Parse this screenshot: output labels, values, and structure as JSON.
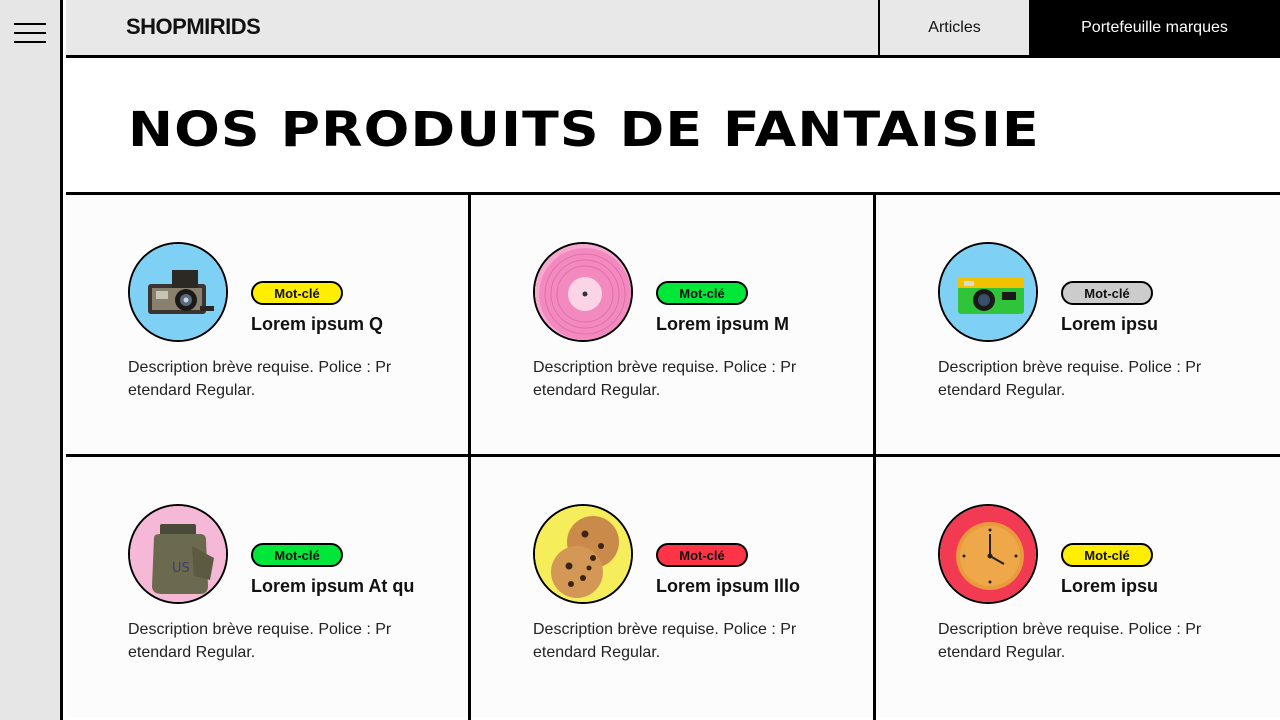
{
  "brand": "SHOPMIRIDS",
  "nav": {
    "articles": "Articles",
    "brands": "Portefeuille marques"
  },
  "hero": {
    "title": "NOS PRODUITS DE FANTAISIE"
  },
  "colors": {
    "yellow": "#ffee00",
    "green": "#00e639",
    "grey": "#cccccc",
    "red": "#ff3547",
    "sky": "#7fd0f5",
    "pink": "#f7a8cf"
  },
  "products": [
    {
      "keyword": "Mot-clé",
      "badge_color": "#ffee00",
      "title": "Lorem ipsum Q",
      "description": "Description brève requise. Police : Pretendard Regular.",
      "image": "vintage-camera-icon",
      "image_bg": "#7fd0f5"
    },
    {
      "keyword": "Mot-clé",
      "badge_color": "#00e639",
      "title": "Lorem ipsum M",
      "description": "Description brève requise. Police : Pretendard Regular.",
      "image": "vinyl-record-icon",
      "image_bg": "#f7a8cf"
    },
    {
      "keyword": "Mot-clé",
      "badge_color": "#cccccc",
      "title": "Lorem ipsu",
      "description": "Description brève requise. Police : Pretendard Regular.",
      "image": "disposable-camera-icon",
      "image_bg": "#7fd0f5"
    },
    {
      "keyword": "Mot-clé",
      "badge_color": "#00e639",
      "title": "Lorem ipsum At qu",
      "description": "Description brève requise. Police : Pretendard Regular.",
      "image": "canteen-pouch-icon",
      "image_bg": "#f5b8d6"
    },
    {
      "keyword": "Mot-clé",
      "badge_color": "#ff3547",
      "title": "Lorem ipsum Illo",
      "description": "Description brève requise. Police : Pretendard Regular.",
      "image": "cookies-icon",
      "image_bg": "#f5ee5a"
    },
    {
      "keyword": "Mot-clé",
      "badge_color": "#ffee00",
      "title": "Lorem ipsu",
      "description": "Description brève requise. Police : Pretendard Regular.",
      "image": "wall-clock-icon",
      "image_bg": "#f23a52"
    }
  ]
}
